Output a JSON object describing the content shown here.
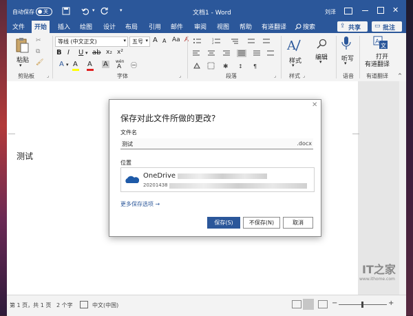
{
  "titlebar": {
    "autosave_label": "自动保存",
    "toggle_state": "关",
    "doc_title": "文档1 - Word",
    "user": "刘泽"
  },
  "ribbon": {
    "tabs": [
      "文件",
      "开始",
      "插入",
      "绘图",
      "设计",
      "布局",
      "引用",
      "邮件",
      "审阅",
      "视图",
      "帮助",
      "有道翻译"
    ],
    "search": "搜索",
    "share": "共享",
    "comments": "批注",
    "clipboard": {
      "paste": "粘贴",
      "group": "剪贴板"
    },
    "font": {
      "name": "等线 (中文正文)",
      "size": "五号",
      "group": "字体",
      "a_grow": "A",
      "a_shrink": "A",
      "font_color_letter": "A",
      "wen": "wén",
      "highlight": "A",
      "ruby": "A"
    },
    "paragraph": {
      "group": "段落"
    },
    "styles": {
      "label": "样式",
      "group": "样式"
    },
    "editing": {
      "label": "编辑"
    },
    "voice": {
      "label": "听写",
      "group": "语音"
    },
    "translate": {
      "label_line1": "打开",
      "label_line2": "有道翻译",
      "group": "有道翻译"
    }
  },
  "document": {
    "text": "测试"
  },
  "statusbar": {
    "page": "第 1 页，共 1 页",
    "words": "2 个字",
    "language": "中文(中国)"
  },
  "dialog": {
    "title": "保存对此文件所做的更改?",
    "filename_label": "文件名",
    "filename_value": "测试",
    "extension": ".docx",
    "location_label": "位置",
    "location_name": "OneDrive",
    "location_sub": "20201438",
    "more_options": "更多保存选项 →",
    "save": "保存(S)",
    "dont_save": "不保存(N)",
    "cancel": "取消"
  },
  "watermark": {
    "logo": "IT之家",
    "url": "www.ithome.com"
  }
}
